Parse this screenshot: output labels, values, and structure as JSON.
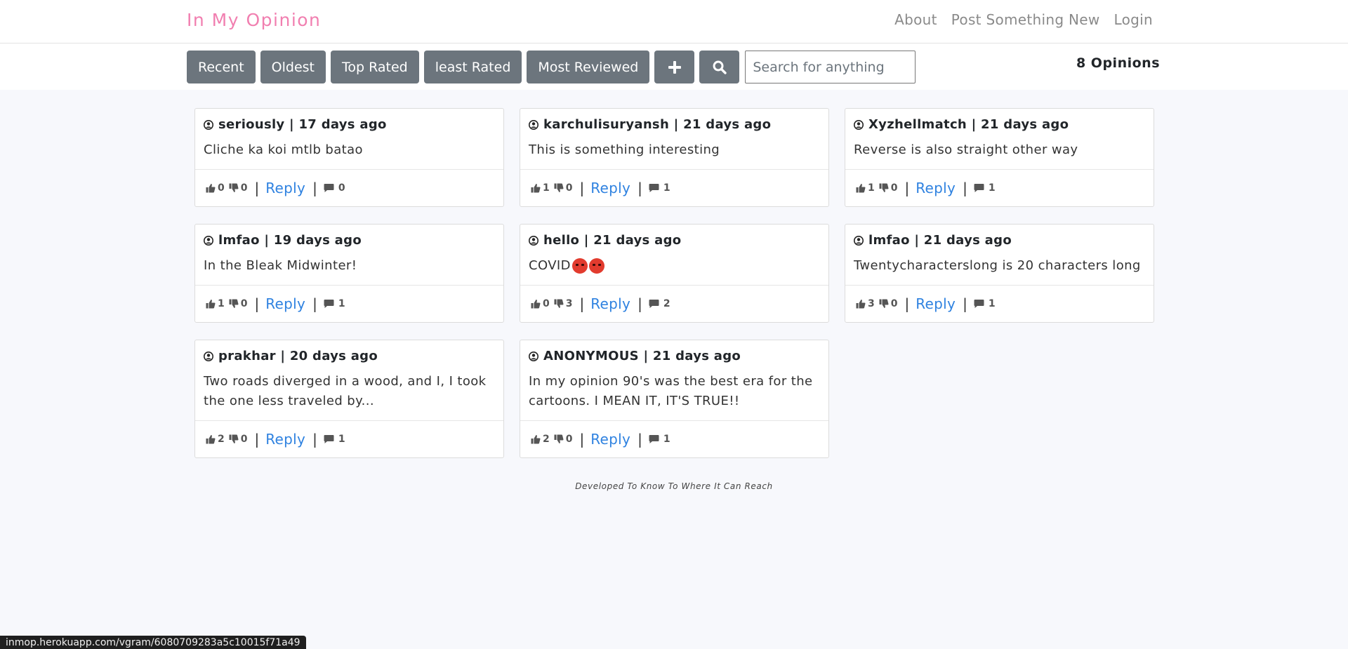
{
  "nav": {
    "brand": "In My Opinion",
    "links": [
      "About",
      "Post Something New",
      "Login"
    ]
  },
  "toolbar": {
    "sort_buttons": [
      "Recent",
      "Oldest",
      "Top Rated",
      "least Rated",
      "Most Reviewed"
    ],
    "add_icon": "plus-icon",
    "search_icon": "search-icon",
    "search_placeholder": "Search for anything",
    "count_label": "8 Opinions"
  },
  "cards": [
    {
      "title": "seriously | 17 days ago",
      "text": "Cliche ka koi mtlb batao",
      "likes": "0",
      "dislikes": "0",
      "reply": "Reply",
      "comments": "0"
    },
    {
      "title": "karchulisuryansh | 21 days ago",
      "text": "This is something interesting",
      "likes": "1",
      "dislikes": "0",
      "reply": "Reply",
      "comments": "1"
    },
    {
      "title": "Xyzhellmatch | 21 days ago",
      "text": "Reverse is also straight other way",
      "likes": "1",
      "dislikes": "0",
      "reply": "Reply",
      "comments": "1"
    },
    {
      "title": "lmfao | 19 days ago",
      "text": "In the Bleak Midwinter!",
      "likes": "1",
      "dislikes": "0",
      "reply": "Reply",
      "comments": "1"
    },
    {
      "title": "hello | 21 days ago",
      "text": "COVID",
      "emoji_count": 2,
      "likes": "0",
      "dislikes": "3",
      "reply": "Reply",
      "comments": "2"
    },
    {
      "title": "lmfao | 21 days ago",
      "text": "Twentycharacterslong is 20 characters long",
      "likes": "3",
      "dislikes": "0",
      "reply": "Reply",
      "comments": "1"
    },
    {
      "title": "prakhar | 20 days ago",
      "text": "Two roads diverged in a wood, and I, I took the one less traveled by...",
      "likes": "2",
      "dislikes": "0",
      "reply": "Reply",
      "comments": "1"
    },
    {
      "title": "ANONYMOUS | 21 days ago",
      "text": "In my opinion 90's was the best era for the cartoons. I MEAN IT, IT'S TRUE!!",
      "likes": "2",
      "dislikes": "0",
      "reply": "Reply",
      "comments": "1"
    }
  ],
  "footer_note": "Developed To Know To Where It Can Reach",
  "status_url": "inmop.herokuapp.com/vgram/6080709283a5c10015f71a49"
}
